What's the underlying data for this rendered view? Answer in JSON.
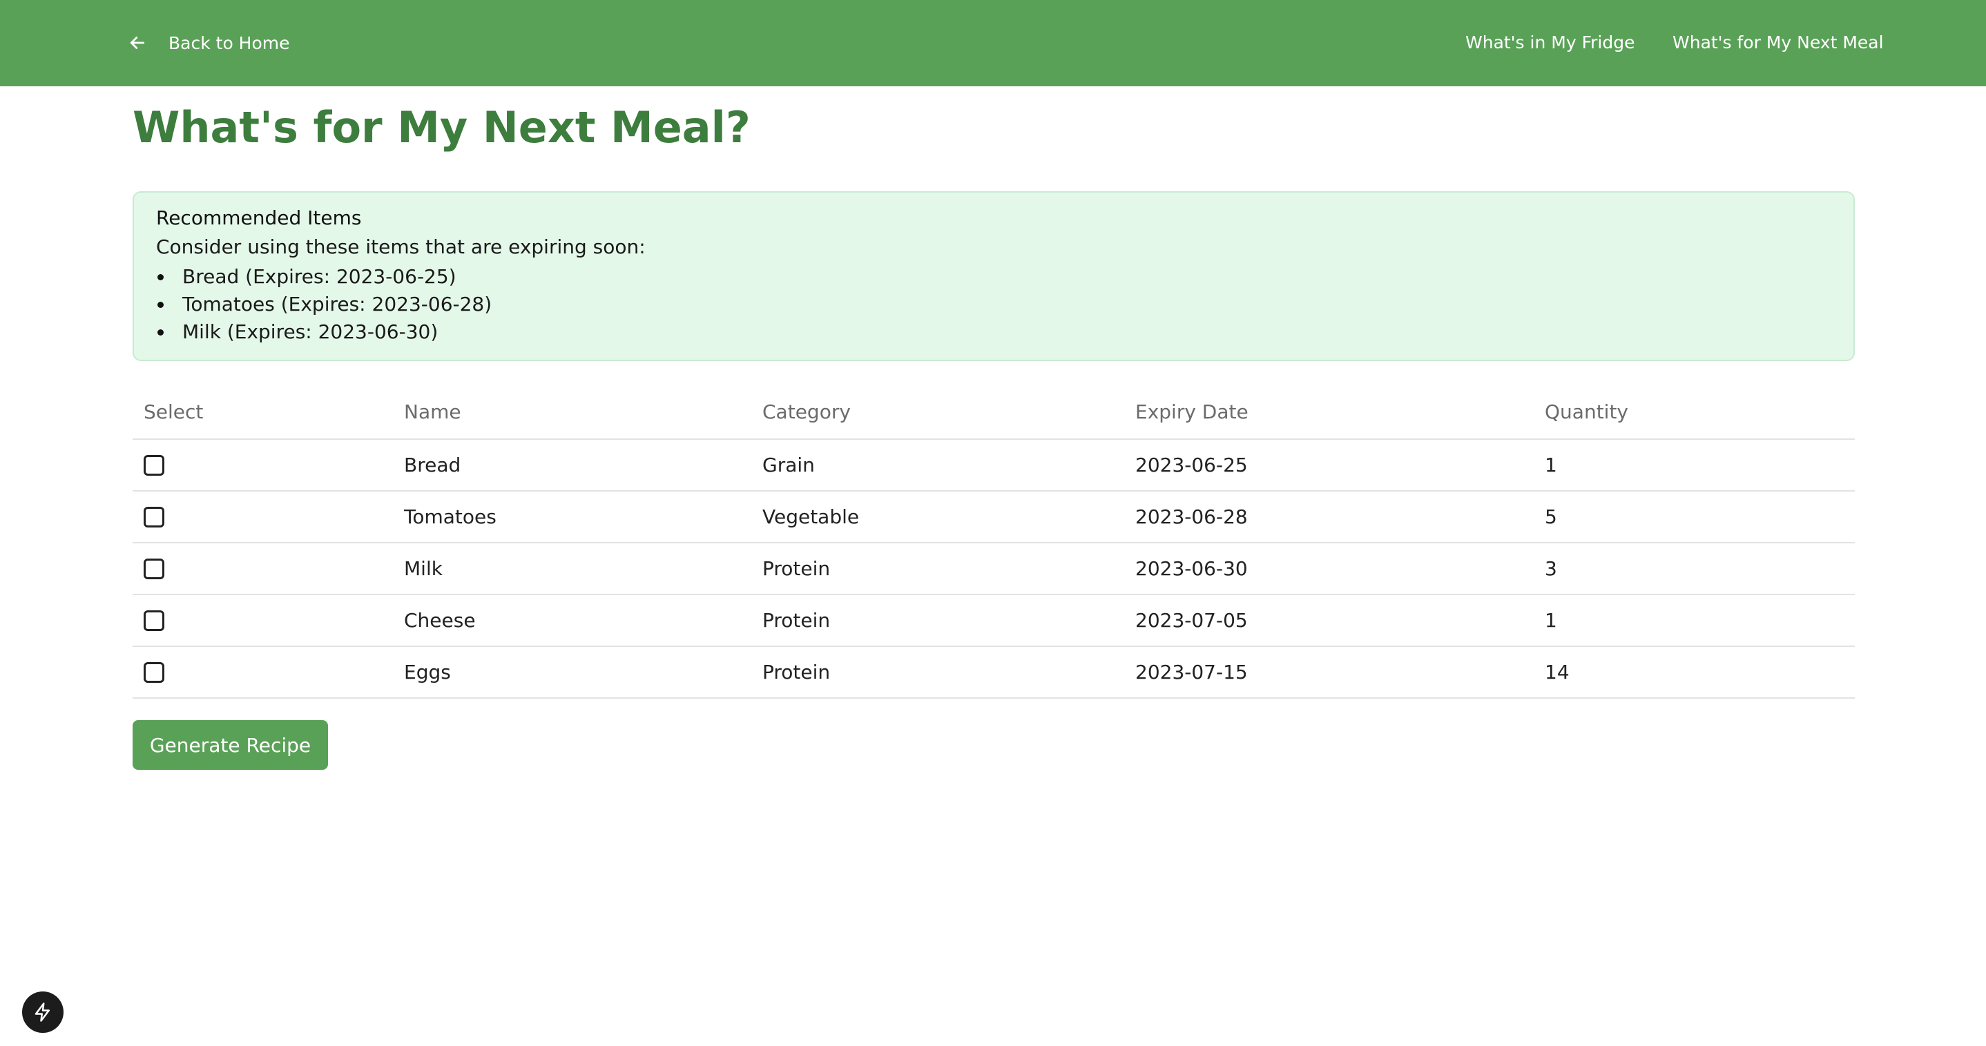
{
  "header": {
    "back_label": "Back to Home",
    "nav": {
      "fridge": "What's in My Fridge",
      "next_meal": "What's for My Next Meal"
    }
  },
  "page_title": "What's for My Next Meal?",
  "recommended": {
    "title": "Recommended Items",
    "description": "Consider using these items that are expiring soon:",
    "items": [
      "Bread (Expires: 2023-06-25)",
      "Tomatoes (Expires: 2023-06-28)",
      "Milk (Expires: 2023-06-30)"
    ]
  },
  "table": {
    "columns": [
      "Select",
      "Name",
      "Category",
      "Expiry Date",
      "Quantity"
    ],
    "rows": [
      {
        "name": "Bread",
        "category": "Grain",
        "expiry": "2023-06-25",
        "quantity": "1",
        "selected": false
      },
      {
        "name": "Tomatoes",
        "category": "Vegetable",
        "expiry": "2023-06-28",
        "quantity": "5",
        "selected": false
      },
      {
        "name": "Milk",
        "category": "Protein",
        "expiry": "2023-06-30",
        "quantity": "3",
        "selected": false
      },
      {
        "name": "Cheese",
        "category": "Protein",
        "expiry": "2023-07-05",
        "quantity": "1",
        "selected": false
      },
      {
        "name": "Eggs",
        "category": "Protein",
        "expiry": "2023-07-15",
        "quantity": "14",
        "selected": false
      }
    ]
  },
  "generate_label": "Generate Recipe",
  "icons": {
    "back": "arrow-left-icon",
    "fab": "lightning-bolt-icon"
  },
  "colors": {
    "header_bg": "#5aa158",
    "title": "#3d7d3d",
    "reco_bg": "#e4f8e9",
    "button_bg": "#5aa158"
  }
}
